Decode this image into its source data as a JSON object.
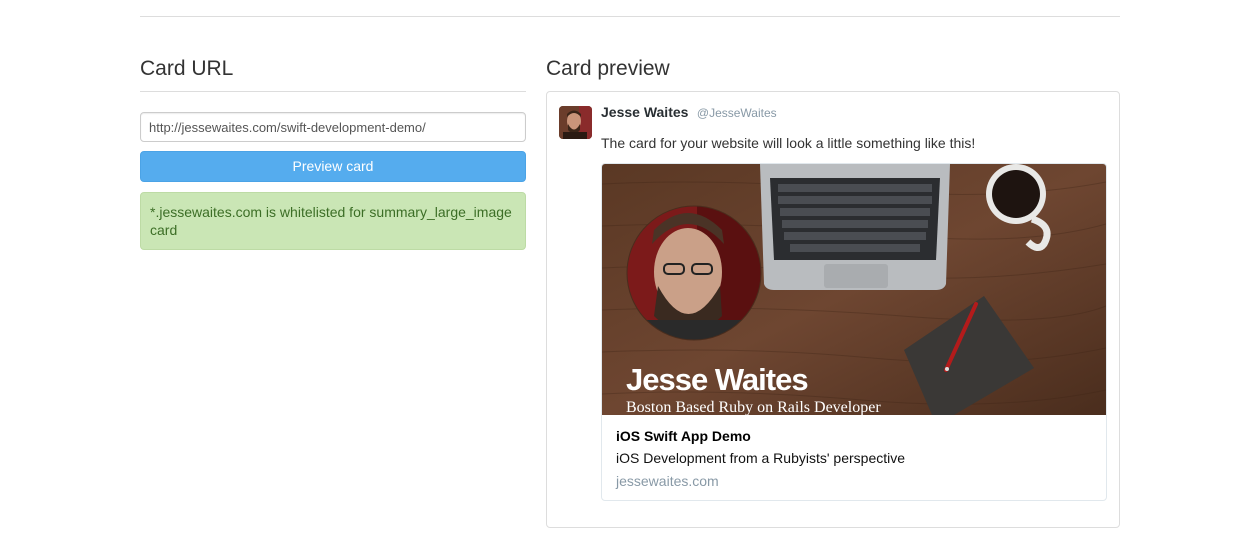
{
  "left": {
    "heading": "Card URL",
    "url_value": "http://jessewaites.com/swift-development-demo/",
    "button_label": "Preview card",
    "alert_text": "*.jessewaites.com is whitelisted for summary_large_image card"
  },
  "right": {
    "heading": "Card preview",
    "tweet": {
      "author_name": "Jesse Waites",
      "author_handle": "@JesseWaites",
      "text": "The card for your website will look a little something like this!"
    },
    "card": {
      "image_headline": "Jesse Waites",
      "image_subline": "Boston Based Ruby on Rails Developer",
      "title": "iOS Swift App Demo",
      "description": "iOS Development from a Rubyists' perspective",
      "domain": "jessewaites.com"
    }
  },
  "colors": {
    "button": "#55acee",
    "alert_bg": "#cae6b5",
    "alert_text": "#3c6e26",
    "muted": "#8899a6"
  }
}
